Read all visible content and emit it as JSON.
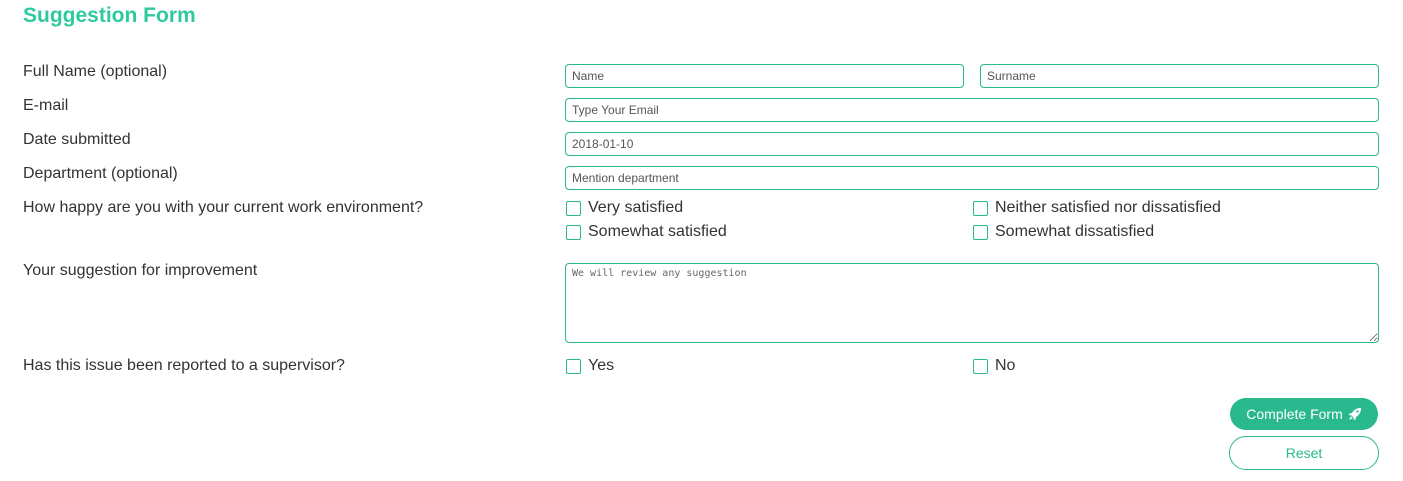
{
  "form": {
    "title": "Suggestion Form",
    "full_name": {
      "label": "Full Name (optional)",
      "first_placeholder": "Name",
      "last_placeholder": "Surname"
    },
    "email": {
      "label": "E-mail",
      "placeholder": "Type Your Email"
    },
    "date": {
      "label": "Date submitted",
      "value": "2018-01-10"
    },
    "department": {
      "label": "Department (optional)",
      "placeholder": "Mention department"
    },
    "happiness": {
      "label": "How happy are you with your current work environment?",
      "options": [
        "Very satisfied",
        "Neither satisfied nor dissatisfied",
        "Somewhat satisfied",
        "Somewhat dissatisfied"
      ]
    },
    "suggestion": {
      "label": "Your suggestion for improvement",
      "placeholder": "We will review any suggestion"
    },
    "reported": {
      "label": "Has this issue been reported to a supervisor?",
      "options": [
        "Yes",
        "No"
      ]
    },
    "buttons": {
      "complete": "Complete Form",
      "reset": "Reset"
    }
  },
  "colors": {
    "accent": "#2ab88e",
    "title": "#2ec99d"
  }
}
